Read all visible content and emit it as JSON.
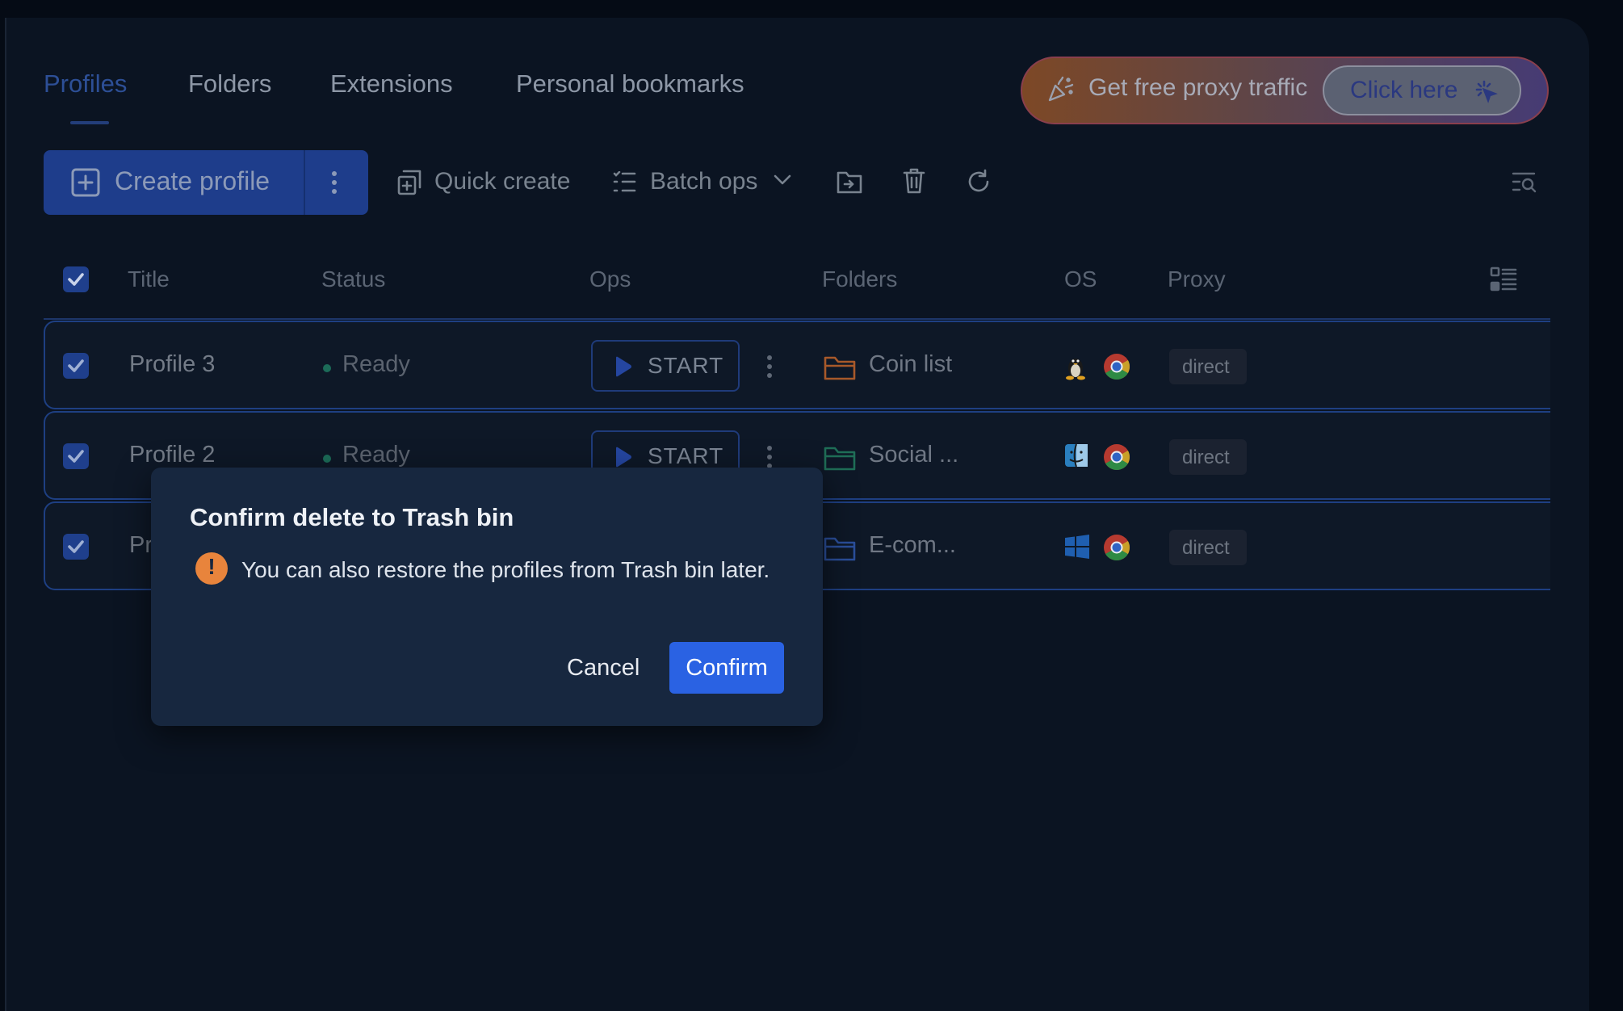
{
  "tabs": [
    {
      "label": "Profiles",
      "active": true
    },
    {
      "label": "Folders",
      "active": false
    },
    {
      "label": "Extensions",
      "active": false
    },
    {
      "label": "Personal bookmarks",
      "active": false
    }
  ],
  "promo": {
    "text": "Get free proxy traffic",
    "button_label": "Click here"
  },
  "toolbar": {
    "create_label": "Create profile",
    "quick_create_label": "Quick create",
    "batch_ops_label": "Batch ops"
  },
  "table": {
    "headers": {
      "title": "Title",
      "status": "Status",
      "ops": "Ops",
      "folders": "Folders",
      "os": "OS",
      "proxy": "Proxy"
    },
    "rows": [
      {
        "title": "Profile 3",
        "status": "Ready",
        "op_label": "START",
        "folder": "Coin list",
        "folder_color": "#c26a2e",
        "os_icon": "linux-icon",
        "browser_icon": "chrome-icon",
        "proxy": "direct",
        "checked": true
      },
      {
        "title": "Profile 2",
        "status": "Ready",
        "op_label": "START",
        "folder": "Social ...",
        "folder_color": "#1f6e57",
        "os_icon": "macos-icon",
        "browser_icon": "chrome-icon",
        "proxy": "direct",
        "checked": true
      },
      {
        "title": "Pr",
        "status": "",
        "op_label": "",
        "folder": "E-com...",
        "folder_color": "#2a4e9a",
        "os_icon": "windows-icon",
        "browser_icon": "chrome-icon",
        "proxy": "direct",
        "checked": true
      }
    ]
  },
  "dialog": {
    "title": "Confirm delete to Trash bin",
    "message": "You can also restore the profiles from Trash bin later.",
    "cancel_label": "Cancel",
    "confirm_label": "Confirm"
  },
  "colors": {
    "accent": "#2a62e3",
    "warning": "#e8843c",
    "background": "#0b1422"
  }
}
